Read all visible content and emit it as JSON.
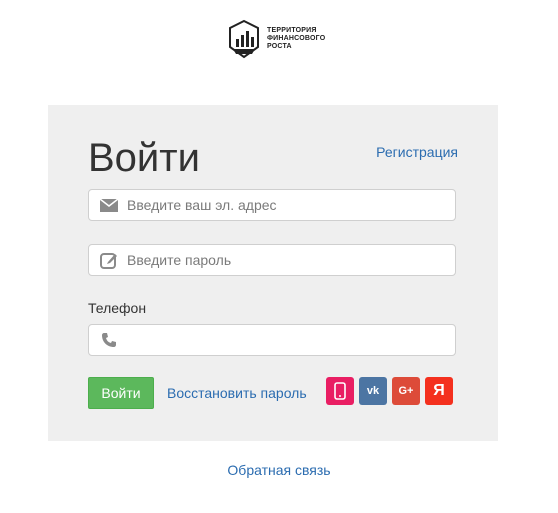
{
  "brand": {
    "line1": "ТЕРРИТОРИЯ",
    "line2": "ФИНАНСОВОГО",
    "line3": "РОСТА"
  },
  "login": {
    "title": "Войти",
    "register_link": "Регистрация",
    "email_placeholder": "Введите ваш эл. адрес",
    "password_placeholder": "Введите пароль",
    "phone_label": "Телефон",
    "phone_value": "",
    "submit_label": "Войти",
    "restore_link": "Восстановить пароль"
  },
  "social": [
    {
      "name": "phone",
      "color": "#e91e63"
    },
    {
      "name": "vk",
      "color": "#4c75a3",
      "text": "vk"
    },
    {
      "name": "google-plus",
      "color": "#dd4b39",
      "text": "G+"
    },
    {
      "name": "yandex",
      "color": "#f4301e",
      "text": "Я"
    }
  ],
  "footer": {
    "feedback_link": "Обратная связь"
  }
}
